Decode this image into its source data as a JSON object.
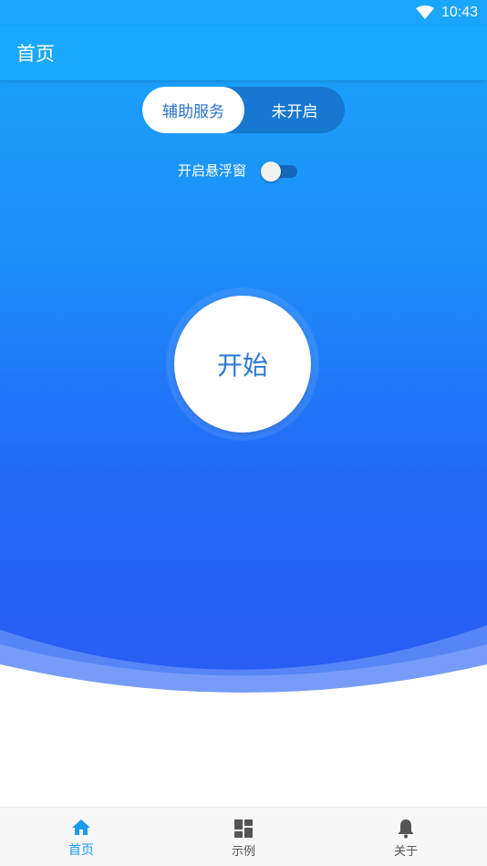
{
  "status_bar": {
    "time": "10:43",
    "wifi_icon": "wifi-icon"
  },
  "app_bar": {
    "title": "首页"
  },
  "segment": {
    "left_label": "辅助服务",
    "right_label": "未开启"
  },
  "floating_window": {
    "label": "开启悬浮窗",
    "enabled": false
  },
  "start_button": {
    "label": "开始"
  },
  "bottom_nav": {
    "items": [
      {
        "label": "首页",
        "icon": "home-icon",
        "active": true
      },
      {
        "label": "示例",
        "icon": "dashboard-icon",
        "active": false
      },
      {
        "label": "关于",
        "icon": "bell-icon",
        "active": false
      }
    ]
  },
  "colors": {
    "accent": "#1a9bf0",
    "hero_top": "#1aa6fb",
    "hero_bottom": "#2a5cf4",
    "start_text": "#2a7ad0"
  }
}
